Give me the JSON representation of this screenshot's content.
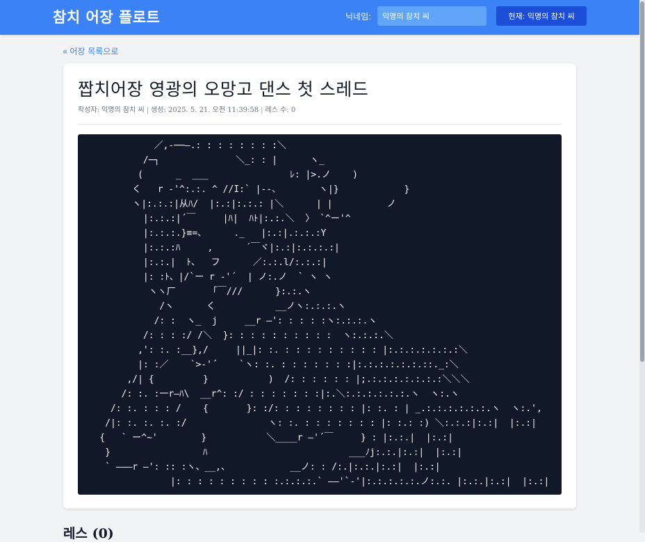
{
  "header": {
    "app_title": "참치 어장 플로트",
    "nickname_label": "닉네임:",
    "nickname_value": "익명의 참치 씨",
    "current_button": "현재: 익명의 참치 씨"
  },
  "nav": {
    "back_label": "어장 목록으로"
  },
  "post": {
    "title": "짭치어장 영광의 오망고 댄스 첫 스레드",
    "author": "작성자: 익명의 참치 씨",
    "created": "생성: 2025. 5. 21. 오전 11:39:58",
    "reply_count": "레스 수: 0",
    "ascii_art": [
      "              ／,-──―.: : : : : : : :＼",
      "            /─┐              ＼_: : |      ヽ_",
      "           (      _  ___               ﾚ: |>.ノ    )",
      "          く   r -'^:.:. ^ //I:` |--、       ヽ|}            }",
      "          ヽ|:.:.:|从ﾊ/  |:.:|:.:.: |＼      | |          ノ",
      "            |:.:.:|´￣     |ﾊ|  ﾊﾄ|:.:.＼  〉 `^ー'^",
      "            |:.:.:.}≡=、     ._   |:.:|.:.:.:Y",
      "            |:.:.:ﾊ     ,      ´￣ヾ|:.:|:.:.:.:|",
      "            |:.:.|  ﾄ、  フ      ／:.:.l/:.:.:|",
      "            |: :ﾄ、|/`ー r -'´  | ノ:.ノ  ` ヽ ヽ",
      "             ヽヽ厂      「￣///      }:.:.ヽ",
      "               /ヽ      く           __ノヽ:.:.:.ヽ",
      "              /: :  ヽ_  j     __r ―': : : : :ヽ:.:.:.ヽ",
      "            /: : : :/ /＼  }: : : : : : : : : :  ヽ:.:.:.＼",
      "           ,': :. :__},/     ||_|: :. : : : : : : : : : |:.:.:.:.:.:.:＼",
      "           |: :／    `>-'´    `ヽ: :. : : : : : : :|:.:.:.:.:.:.::._:＼",
      "         ,/| {         }           )  /: : : : : : |;.:.:.:.:.:.:.:＼＼＼",
      "        /: :. :一r―ﾊ\\  __r^: :/ : : : : : : :|:.＼:.:.:.:.:.:.ヽ  ヽ:.ヽ",
      "      /: :. : : : /    {       }: :/: : : : : : : : |: :. : | _.:.:.:.:.:.:.ヽ  ヽ:.',",
      "     /|: :. :. :. :/               ヽ: :. : : : : : : : |: :.: :) ＼:.:.:|:.:|  |:.:|",
      "    {   ` ー^~'        }           ＼____r ―'´￣     } : |:.:.|  |:.:|",
      "     }                 ﾊ                          ___ﾉj:.:.|:.:|  |:.:|",
      "     ` ―――r ―': :: :ヽ、__,、           __ノ: : /:.|:.:.|:.:|  |:.:|",
      "                 |: : : : : : : : : :.:.:.:.` ――'`‐'|:.:.:.:.:.ノ:.:. |:.:.|:.:|  |:.:|"
    ]
  },
  "replies": {
    "heading": "레스 (0)"
  },
  "colors": {
    "header_bg": "#3b82f6",
    "button_bg": "#1d4ed8",
    "input_bg": "#60a5fa",
    "art_bg": "#111827",
    "link": "#3b82f6"
  }
}
